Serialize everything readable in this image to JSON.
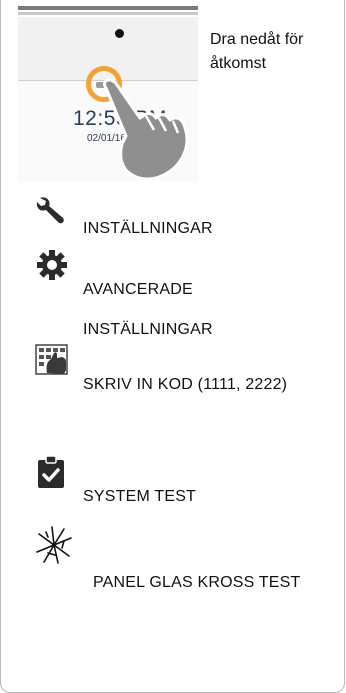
{
  "header": {
    "clock": "12:55",
    "clock_suffix": "PM",
    "date": "02/01/16",
    "instruction": "Dra nedåt för åtkomst"
  },
  "menu": {
    "items": [
      {
        "icon": "wrench-icon",
        "label": "INSTÄLLNINGAR"
      },
      {
        "icon": "gear-icon",
        "label": "AVANCERADE INSTÄLLNINGAR"
      },
      {
        "icon": "keypad-hand-icon",
        "label": "SKRIV IN KOD (1111, 2222)"
      },
      {
        "icon": "clipboard-check-icon",
        "label": "SYSTEM TEST"
      },
      {
        "icon": "glass-break-icon",
        "label": "PANEL GLAS KROSS TEST"
      }
    ]
  },
  "colors": {
    "accent_ring": "#f3a233",
    "clock": "#2d3e55",
    "icon": "#2b2b2b"
  }
}
